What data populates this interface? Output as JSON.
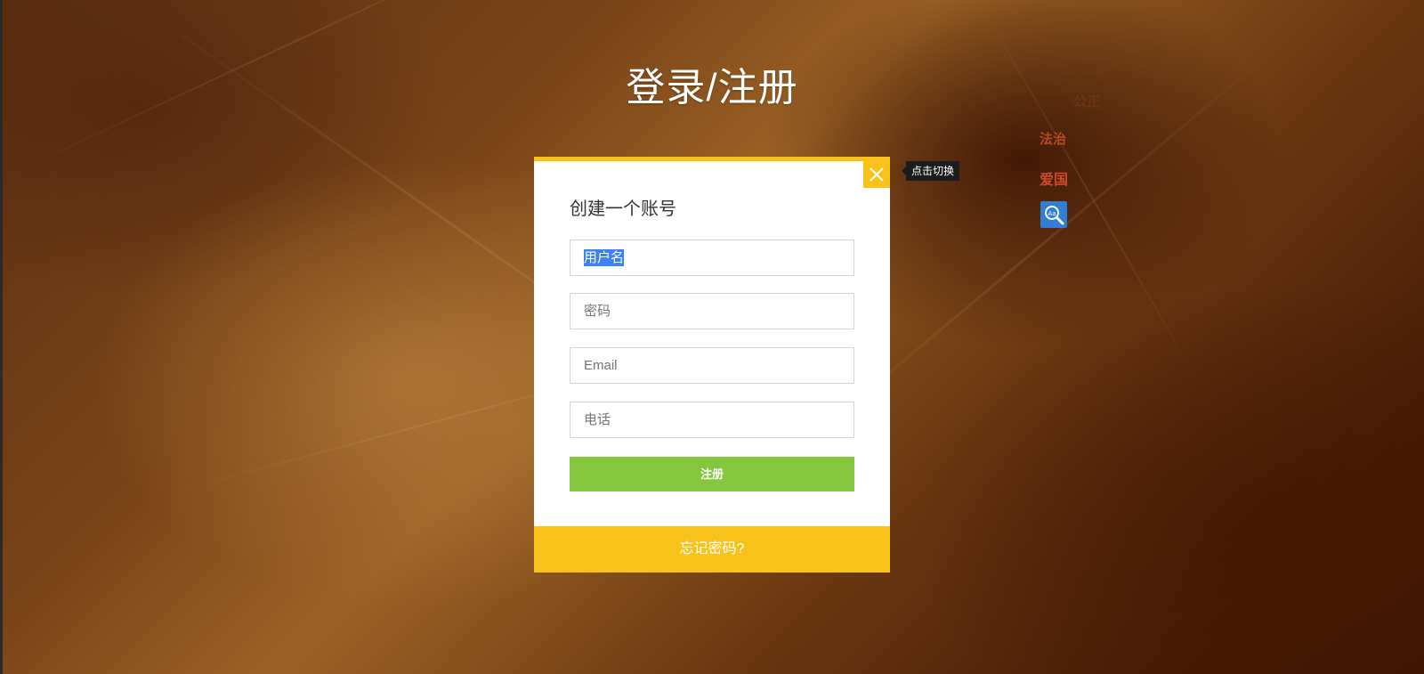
{
  "page": {
    "title": "登录/注册"
  },
  "register_modal": {
    "heading": "创建一个账号",
    "fields": {
      "username": {
        "value": "用户名"
      },
      "password": {
        "placeholder": "密码"
      },
      "email": {
        "placeholder": "Email"
      },
      "phone": {
        "placeholder": "电话"
      }
    },
    "submit_label": "注册",
    "forgot_password_label": "忘记密码?",
    "close_icon": "close-icon",
    "close_tooltip": "点击切换"
  },
  "side_words": [
    {
      "text": "公正",
      "color": "#7a3a1a"
    },
    {
      "text": "法治",
      "color": "#b8482a"
    },
    {
      "text": "爱国",
      "color": "#d04a2a"
    }
  ],
  "side_widget": {
    "icon": "search-translate-icon",
    "color": "#2f7fd6"
  },
  "colors": {
    "accent_yellow": "#f9c21a",
    "submit_green": "#84c73f",
    "selection_blue": "#3b82f6"
  }
}
